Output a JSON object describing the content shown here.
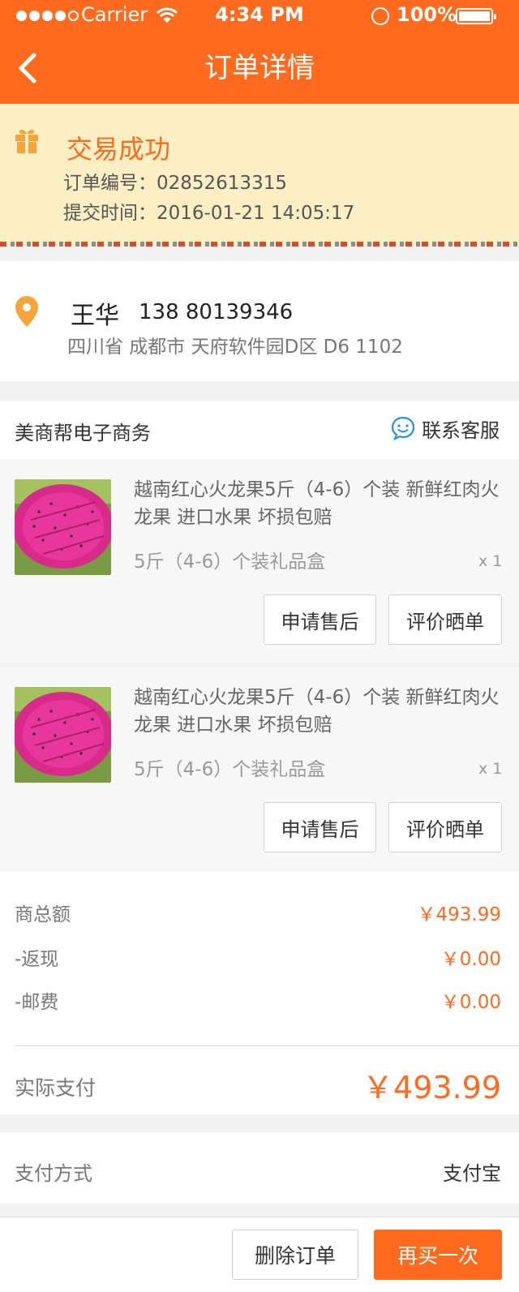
{
  "status_bar": {
    "carrier": "Carrier",
    "time": "4:34 PM",
    "battery": "100%"
  },
  "nav": {
    "title": "订单详情"
  },
  "order_status": {
    "title": "交易成功",
    "order_number": "订单编号：02852613315",
    "submit_time": "提交时间：2016-01-21 14:05:17"
  },
  "address": {
    "name": "王华",
    "phone": "138 80139346",
    "detail": "四川省 成都市 天府软件园D区 D6 1102"
  },
  "shop": {
    "name": "美商帮电子商务",
    "contact_label": "联系客服"
  },
  "items": [
    {
      "title": "越南红心火龙果5斤（4-6）个装 新鲜红肉火龙果 进口水果 坏损包赔",
      "spec": "5斤（4-6）个装礼品盒",
      "qty": "x 1",
      "refund_label": "申请售后",
      "review_label": "评价晒单"
    },
    {
      "title": "越南红心火龙果5斤（4-6）个装 新鲜红肉火龙果 进口水果 坏损包赔",
      "spec": "5斤（4-6）个装礼品盒",
      "qty": "x 1",
      "refund_label": "申请售后",
      "review_label": "评价晒单"
    }
  ],
  "summary": {
    "rows": [
      {
        "label": "商总额",
        "value": "￥493.99"
      },
      {
        "label": "-返现",
        "value": "￥0.00"
      },
      {
        "label": "-邮费",
        "value": "￥0.00"
      }
    ],
    "paid_label": "实际支付",
    "paid_value": "￥493.99"
  },
  "payment": {
    "label": "支付方式",
    "value": "支付宝"
  },
  "actions": {
    "delete_label": "删除订单",
    "rebuy_label": "再买一次"
  },
  "colors": {
    "accent": "#ff6a1e",
    "banner": "#fdefc3",
    "pin": "#f7a43b"
  }
}
